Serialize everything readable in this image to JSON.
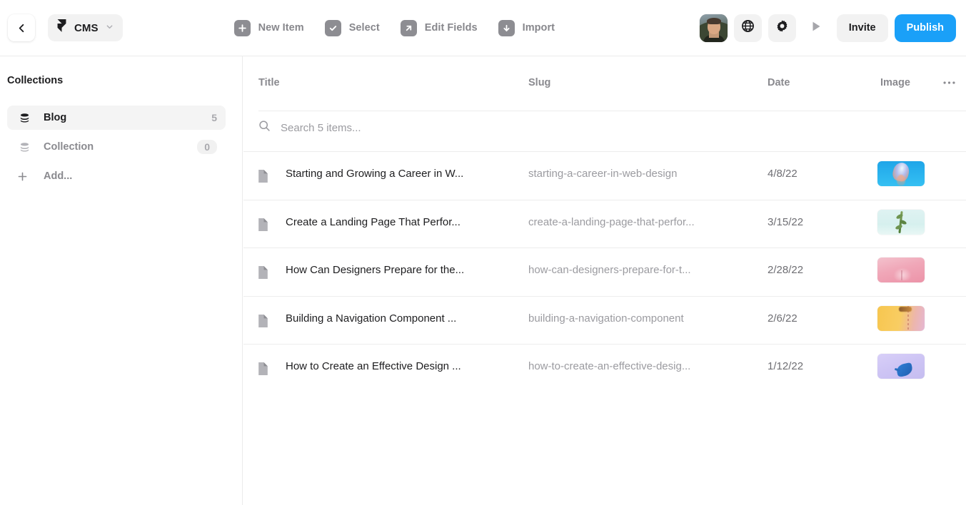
{
  "toolbar": {
    "back_icon": "chevron-left-icon",
    "project_chip": {
      "logo_icon": "framer-logo-icon",
      "label": "CMS",
      "caret_icon": "chevron-down-icon"
    },
    "actions": [
      {
        "icon": "plus-icon",
        "label": "New Item"
      },
      {
        "icon": "checkmark-icon",
        "label": "Select"
      },
      {
        "icon": "arrow-up-right-icon",
        "label": "Edit Fields"
      },
      {
        "icon": "arrow-down-icon",
        "label": "Import"
      }
    ],
    "avatar": {
      "icon": "avatar",
      "alt": "user-avatar"
    },
    "globe_icon": "globe-icon",
    "settings_icon": "gear-icon",
    "preview_icon": "play-icon",
    "invite_label": "Invite",
    "publish_label": "Publish",
    "accent_color": "#1aa0f8",
    "badge_color": "#8d8d92"
  },
  "sidebar": {
    "title": "Collections",
    "items": [
      {
        "icon": "database-icon",
        "label": "Blog",
        "count": "5",
        "active": true
      },
      {
        "icon": "database-icon",
        "label": "Collection",
        "count": "0",
        "active": false
      }
    ],
    "add": {
      "icon": "plus-icon",
      "label": "Add..."
    }
  },
  "table": {
    "columns": [
      "Title",
      "Slug",
      "Date",
      "Image"
    ],
    "more_icon": "ellipsis-icon",
    "search": {
      "icon": "search-icon",
      "placeholder": "Search 5 items...",
      "value": ""
    },
    "rows": [
      {
        "icon": "document-icon",
        "title": "Starting and Growing a Career in W...",
        "slug": "starting-a-career-in-web-design",
        "date": "4/8/22",
        "image": "thumbnail-jellyfish-blue"
      },
      {
        "icon": "document-icon",
        "title": "Create a Landing Page That Perfor...",
        "slug": "create-a-landing-page-that-perfor...",
        "date": "3/15/22",
        "image": "thumbnail-plant-cyan"
      },
      {
        "icon": "document-icon",
        "title": "How Can Designers Prepare for the...",
        "slug": "how-can-designers-prepare-for-t...",
        "date": "2/28/22",
        "image": "thumbnail-flower-pink"
      },
      {
        "icon": "document-icon",
        "title": "Building a Navigation Component ...",
        "slug": "building-a-navigation-component",
        "date": "2/6/22",
        "image": "thumbnail-yellow-gradient"
      },
      {
        "icon": "document-icon",
        "title": "How to Create an Effective Design ...",
        "slug": "how-to-create-an-effective-desig...",
        "date": "1/12/22",
        "image": "thumbnail-bird-purple"
      }
    ]
  }
}
